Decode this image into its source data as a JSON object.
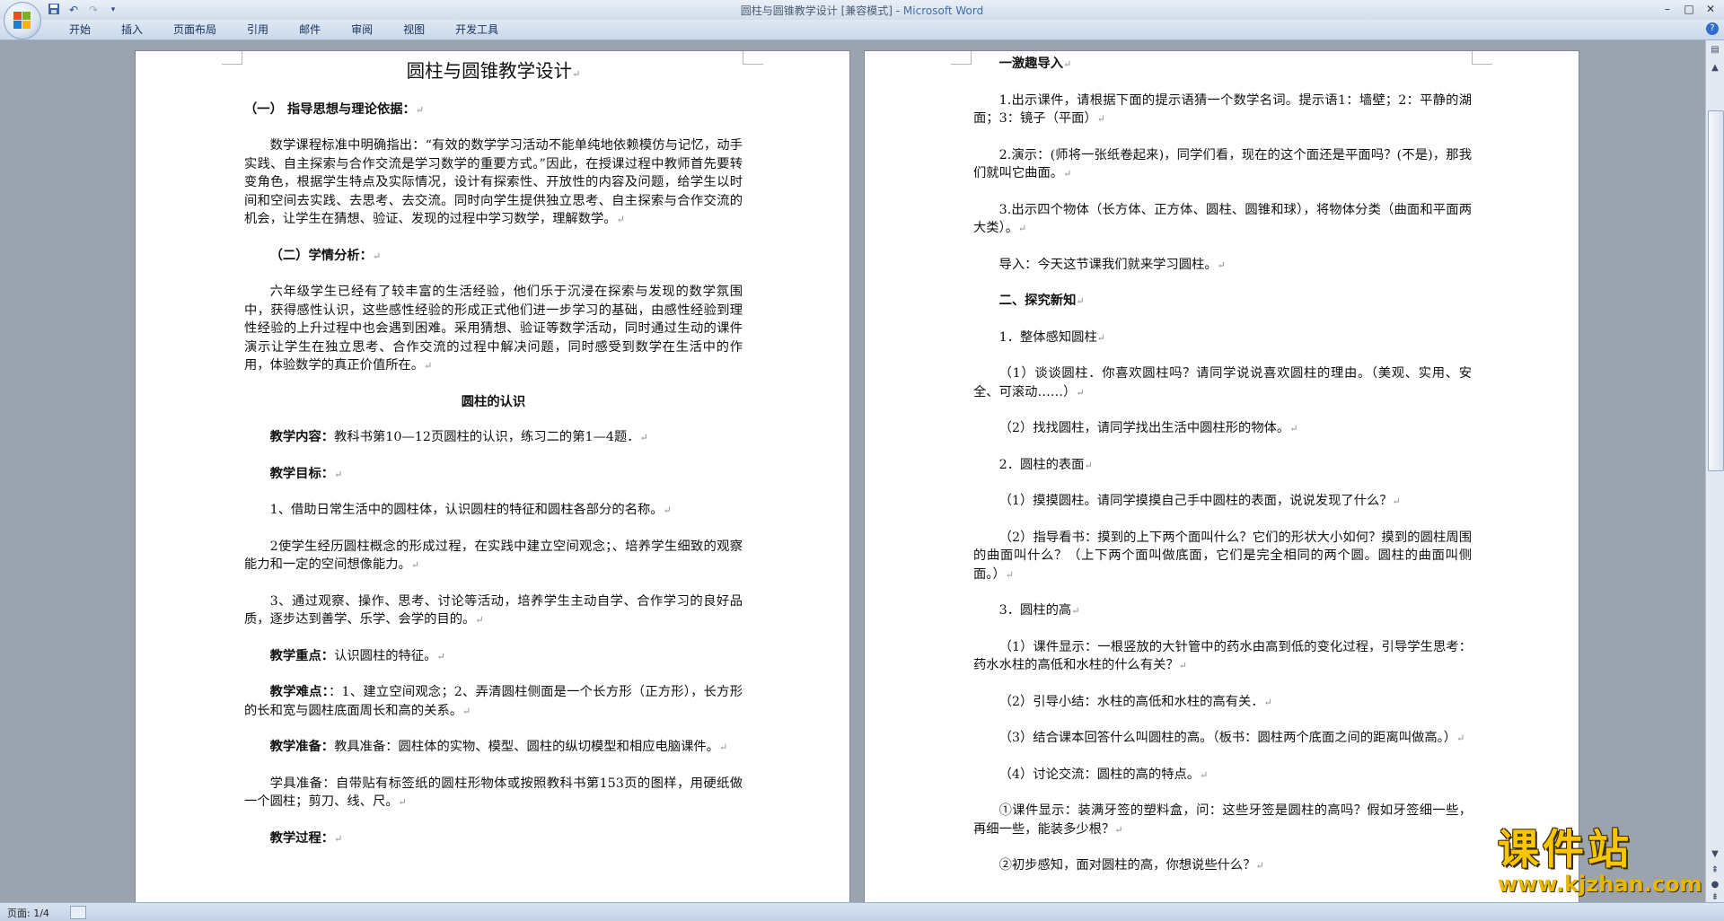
{
  "window": {
    "doc_name": "圆柱与圆锥教学设计 [兼容模式] - ",
    "app_name": "Microsoft Word",
    "minimize_glyph": "–",
    "maximize_glyph": "□",
    "close_glyph": "✕"
  },
  "qat": {
    "save_icon": "save-icon",
    "undo_icon": "undo-icon",
    "redo_icon": "redo-icon",
    "customize_glyph": "▾"
  },
  "ribbon": {
    "tabs": [
      "开始",
      "插入",
      "页面布局",
      "引用",
      "邮件",
      "审阅",
      "视图",
      "开发工具"
    ],
    "help_glyph": "?"
  },
  "left_page": {
    "title": "圆柱与圆锥教学设计",
    "paras": [
      {
        "label": "（一） 指导思想与理论依据：",
        "text": ""
      },
      {
        "label": "",
        "text": "数学课程标准中明确指出：“有效的数学学习活动不能单纯地依赖模仿与记忆，动手实践、自主探索与合作交流是学习数学的重要方式。”因此，在授课过程中教师首先要转变角色，根据学生特点及实际情况，设计有探索性、开放性的内容及问题，给学生以时间和空间去实践、去思考、去交流。同时向学生提供独立思考、自主探索与合作交流的机会，让学生在猜想、验证、发现的过程中学习数学，理解数学。"
      },
      {
        "label": "（二）学情分析：",
        "text": ""
      },
      {
        "label": "",
        "text": "六年级学生已经有了较丰富的生活经验，他们乐于沉浸在探索与发现的数学氛围中，获得感性认识，这些感性经验的形成正式他们进一步学习的基础，由感性经验到理性经验的上升过程中也会遇到困难。采用猜想、验证等数学活动，同时通过生动的课件演示让学生在独立思考、合作交流的过程中解决问题，同时感受到数学在生活中的作用，体验数学的真正价值所在。"
      },
      {
        "label": "圆柱的认识",
        "text": ""
      },
      {
        "label": "教学内容：",
        "text": "教科书第10—12页圆柱的认识，练习二的第1—4题．"
      },
      {
        "label": "教学目标：",
        "text": ""
      },
      {
        "label": "",
        "text": "1、借助日常生活中的圆柱体，认识圆柱的特征和圆柱各部分的名称。"
      },
      {
        "label": "",
        "text": "2使学生经历圆柱概念的形成过程，在实践中建立空间观念；、培养学生细致的观察能力和一定的空间想像能力。"
      },
      {
        "label": "",
        "text": "3、通过观察、操作、思考、讨论等活动，培养学生主动自学、合作学习的良好品质，逐步达到善学、乐学、会学的目的。"
      },
      {
        "label": "教学重点：",
        "text": "认识圆柱的特征。"
      },
      {
        "label": "教学难点：",
        "text": "：1、建立空间观念；2、弄清圆柱侧面是一个长方形（正方形），长方形的长和宽与圆柱底面周长和高的关系。"
      },
      {
        "label": "教学准备：",
        "text": "教具准备：圆柱体的实物、模型、圆柱的纵切模型和相应电脑课件。"
      },
      {
        "label": "",
        "text": "学具准备：自带贴有标签纸的圆柱形物体或按照教科书第153页的图样，用硬纸做一个圆柱；剪刀、线、尺。"
      },
      {
        "label": "教学过程：",
        "text": ""
      }
    ]
  },
  "right_page": {
    "paras": [
      {
        "label": "一激趣导入",
        "text": ""
      },
      {
        "label": "",
        "text": "1.出示课件，请根据下面的提示语猜一个数学名词。提示语1：墙壁；2：平静的湖面；3：镜子（平面）"
      },
      {
        "label": "",
        "text": "2.演示：(师将一张纸卷起来)，同学们看，现在的这个面还是平面吗？(不是)，那我们就叫它曲面。"
      },
      {
        "label": "",
        "text": "3.出示四个物体（长方体、正方体、圆柱、圆锥和球），将物体分类（曲面和平面两大类）。"
      },
      {
        "label": "",
        "text": "导入：今天这节课我们就来学习圆柱。"
      },
      {
        "label": "二、探究新知",
        "text": ""
      },
      {
        "label": "",
        "text": "1．整体感知圆柱"
      },
      {
        "label": "",
        "text": "（1）谈谈圆柱．你喜欢圆柱吗？请同学说说喜欢圆柱的理由。（美观、实用、安全、可滚动……）"
      },
      {
        "label": "",
        "text": "（2）找找圆柱，请同学找出生活中圆柱形的物体。"
      },
      {
        "label": "",
        "text": "2．圆柱的表面"
      },
      {
        "label": "",
        "text": "（1）摸摸圆柱。请同学摸摸自己手中圆柱的表面，说说发现了什么？"
      },
      {
        "label": "",
        "text": "（2）指导看书：摸到的上下两个面叫什么？它们的形状大小如何？摸到的圆柱周围的曲面叫什么？（上下两个面叫做底面，它们是完全相同的两个圆。圆柱的曲面叫侧面。）"
      },
      {
        "label": "",
        "text": "3．圆柱的高"
      },
      {
        "label": "",
        "text": "（1）课件显示：一根竖放的大针管中的药水由高到低的变化过程，引导学生思考：药水水柱的高低和水柱的什么有关？"
      },
      {
        "label": "",
        "text": "（2）引导小结：水柱的高低和水柱的高有关．"
      },
      {
        "label": "",
        "text": "（3）结合课本回答什么叫圆柱的高。（板书：圆柱两个底面之间的距离叫做高。）"
      },
      {
        "label": "",
        "text": "（4）讨论交流：圆柱的高的特点。"
      },
      {
        "label": "",
        "text": "①课件显示：装满牙签的塑料盒，问：这些牙签是圆柱的高吗？假如牙签细一些，再细一些，能装多少根？"
      },
      {
        "label": "",
        "text": "②初步感知，面对圆柱的高，你想说些什么？"
      }
    ]
  },
  "paragraph_mark": "↵",
  "status": {
    "page_info": "页面: 1/4"
  },
  "watermark": {
    "title": "课件站",
    "url": "www.kjzhan.com"
  },
  "colors": {
    "brand_blue": "#3b6fb0",
    "watermark_yellow": "#f7c600"
  }
}
